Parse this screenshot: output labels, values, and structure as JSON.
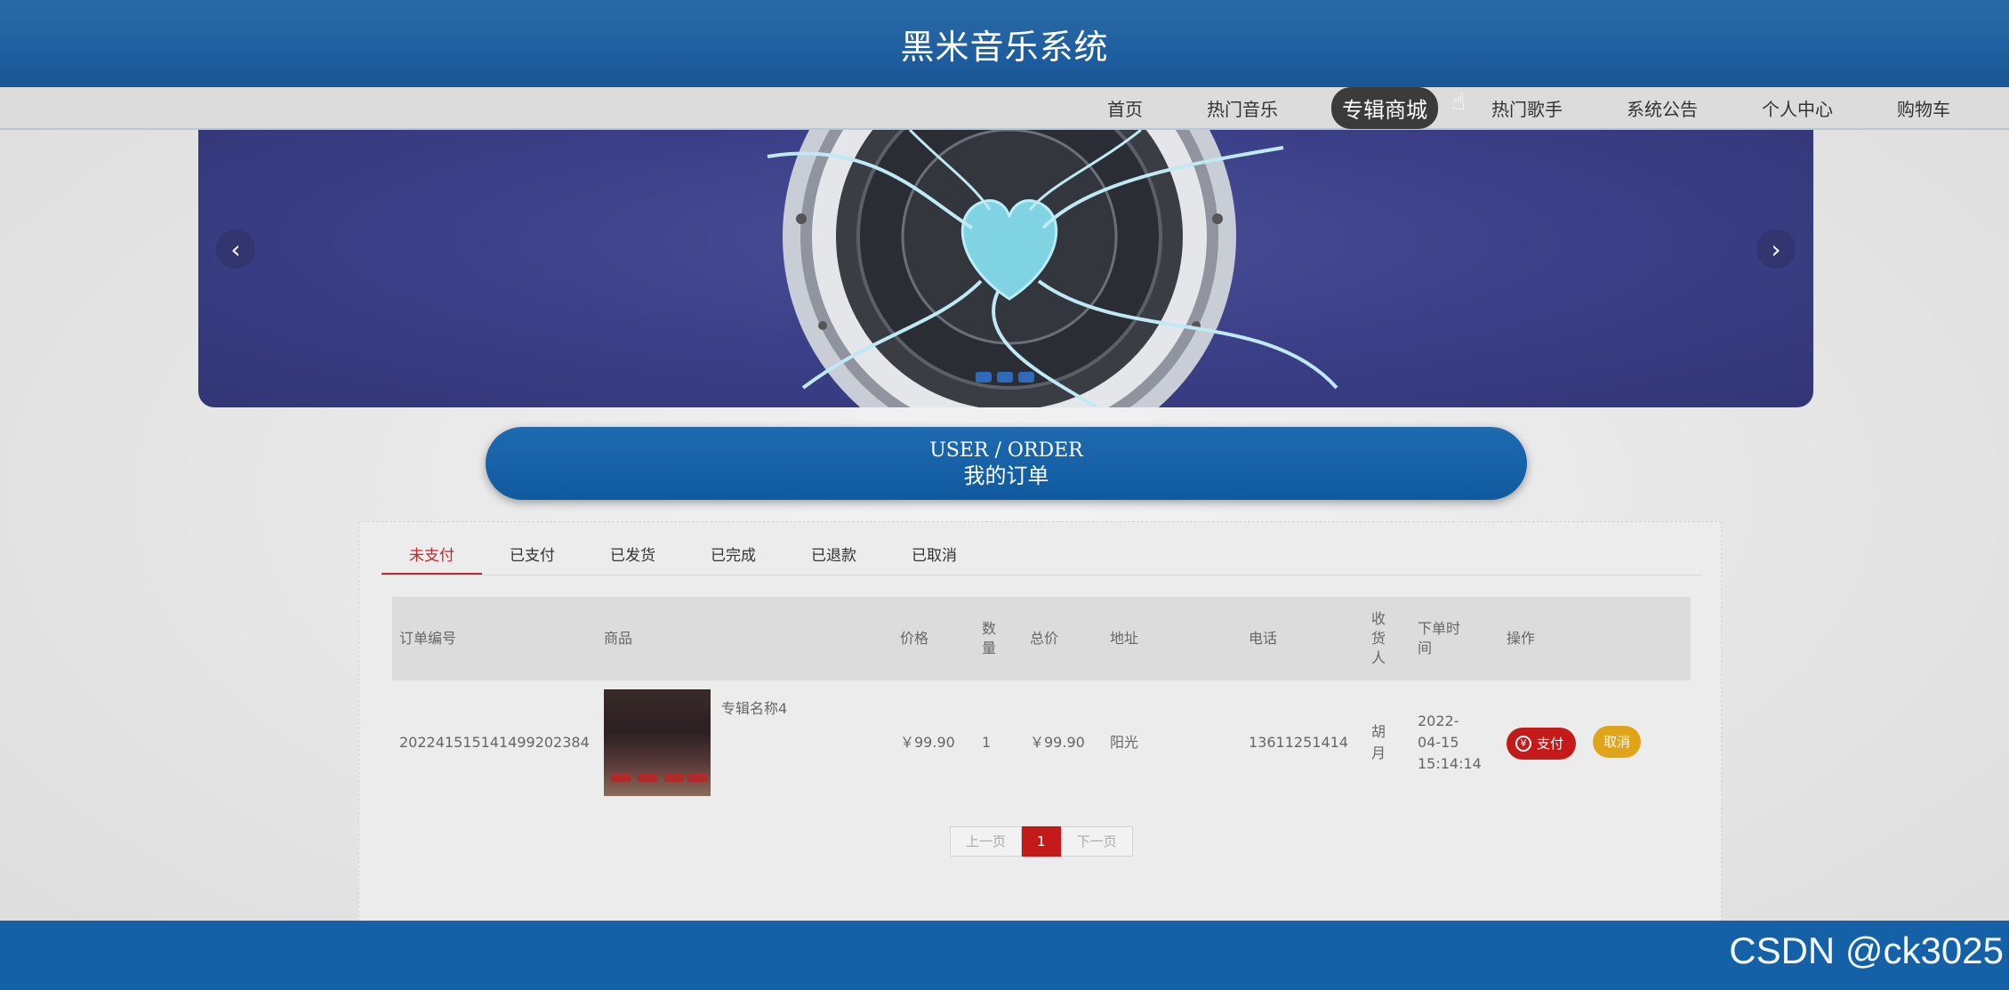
{
  "header": {
    "title": "黑米音乐系统"
  },
  "nav": {
    "items": [
      {
        "label": "首页",
        "active": false
      },
      {
        "label": "热门音乐",
        "active": false
      },
      {
        "label": "专辑商城",
        "active": true
      },
      {
        "label": "热门歌手",
        "active": false
      },
      {
        "label": "系统公告",
        "active": false
      },
      {
        "label": "个人中心",
        "active": false
      },
      {
        "label": "购物车",
        "active": false
      }
    ]
  },
  "banner": {
    "prev_icon": "chevron-left-icon",
    "next_icon": "chevron-right-icon"
  },
  "section": {
    "title_en": "USER / ORDER",
    "title_cn": "我的订单"
  },
  "tabs": [
    "未支付",
    "已支付",
    "已发货",
    "已完成",
    "已退款",
    "已取消"
  ],
  "active_tab": "未支付",
  "table": {
    "headers": [
      "订单编号",
      "商品",
      "价格",
      "数量",
      "总价",
      "地址",
      "电话",
      "收货人",
      "下单时间",
      "操作"
    ],
    "rows": [
      {
        "order_no": "20224151514149920238​4",
        "goods_name": "专辑名称4",
        "price": "￥99.90",
        "quantity": "1",
        "total": "￥99.90",
        "address": "阳光",
        "phone": "13611251414",
        "receiver": "胡月",
        "time": "2022-04-15 15:14:14",
        "pay_label": "支付",
        "cancel_label": "取消"
      }
    ]
  },
  "pager": {
    "prev": "上一页",
    "current": "1",
    "next": "下一页"
  },
  "watermark": "CSDN @ck3025",
  "colors": {
    "header": "#1f5f9f",
    "accent_red": "#c41a1a",
    "cancel_yellow": "#e0a41a",
    "footer": "#1561a8"
  }
}
